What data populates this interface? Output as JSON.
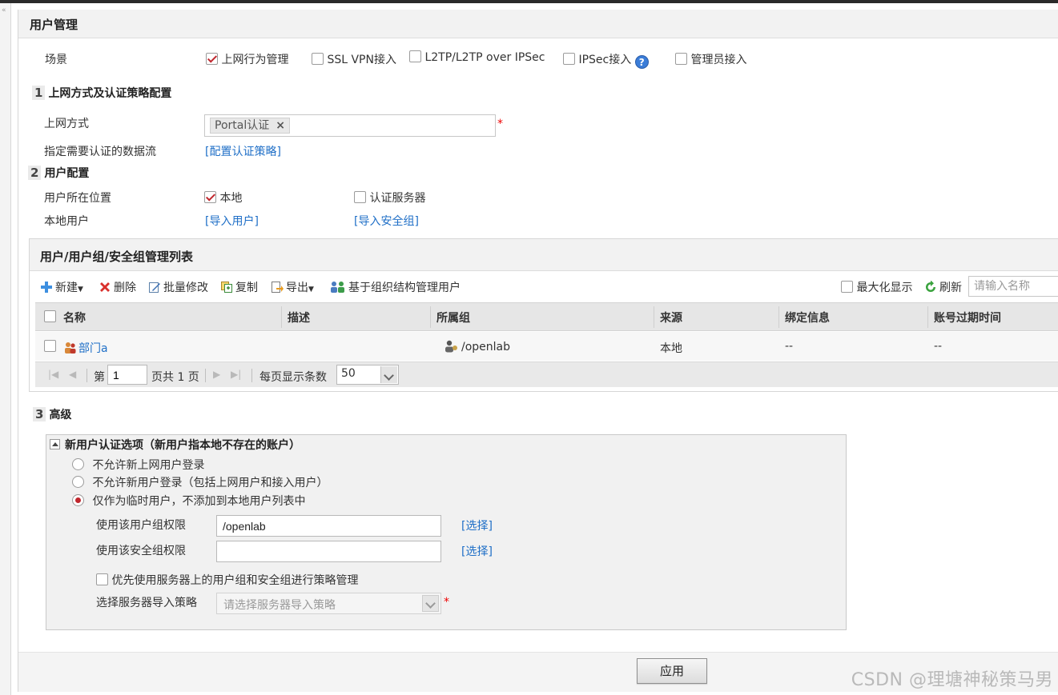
{
  "panel": {
    "title": "用户管理"
  },
  "scene": {
    "label": "场景",
    "options": [
      {
        "label": "上网行为管理",
        "checked": true
      },
      {
        "label": "SSL VPN接入",
        "checked": false
      },
      {
        "label": "L2TP/L2TP over IPSec",
        "checked": false
      },
      {
        "label": "IPSec接入",
        "checked": false,
        "help": "?"
      },
      {
        "label": "管理员接入",
        "checked": false
      }
    ]
  },
  "section1": {
    "num": "1",
    "title": "上网方式及认证策略配置",
    "access_label": "上网方式",
    "access_tag": "Portal认证",
    "tag_remove": "×",
    "required_mark": "*",
    "flow_label": "指定需要认证的数据流",
    "flow_link": "[配置认证策略]"
  },
  "section2": {
    "num": "2",
    "title": "用户配置",
    "location_label": "用户所在位置",
    "location_options": [
      {
        "label": "本地",
        "checked": true
      },
      {
        "label": "认证服务器",
        "checked": false
      }
    ],
    "local_user_label": "本地用户",
    "import_user_link": "[导入用户]",
    "import_group_link": "[导入安全组]"
  },
  "list": {
    "title": "用户/用户组/安全组管理列表",
    "toolbar": {
      "new": "新建",
      "delete": "删除",
      "batch_edit": "批量修改",
      "copy": "复制",
      "export": "导出",
      "org_manage": "基于组织结构管理用户",
      "maximize": "最大化显示",
      "refresh": "刷新",
      "search_placeholder": "请输入名称"
    },
    "columns": [
      "名称",
      "描述",
      "所属组",
      "来源",
      "绑定信息",
      "账号过期时间"
    ],
    "rows": [
      {
        "name": "部门a",
        "desc": "",
        "group": "/openlab",
        "source": "本地",
        "binding": "--",
        "expire": "--"
      }
    ],
    "pager": {
      "page_prefix": "第",
      "page_value": "1",
      "page_suffix": "页共 1 页",
      "per_page_label": "每页显示条数",
      "per_page_value": "50"
    }
  },
  "section3": {
    "num": "3",
    "title": "高级",
    "box_title": "新用户认证选项（新用户指本地不存在的账户）",
    "radios": [
      {
        "label": "不允许新上网用户登录",
        "checked": false
      },
      {
        "label": "不允许新用户登录（包括上网用户和接入用户）",
        "checked": false
      },
      {
        "label": "仅作为临时用户，不添加到本地用户列表中",
        "checked": true
      }
    ],
    "user_group_label": "使用该用户组权限",
    "user_group_value": "/openlab",
    "security_group_label": "使用该安全组权限",
    "security_group_value": "",
    "select_link": "[选择]",
    "prefer_server_label": "优先使用服务器上的用户组和安全组进行策略管理",
    "import_policy_label": "选择服务器导入策略",
    "import_policy_placeholder": "请选择服务器导入策略",
    "required_mark": "*"
  },
  "footer": {
    "apply": "应用"
  },
  "watermark": "CSDN @理塘神秘策马男",
  "colors": {
    "link": "#1f6fc7",
    "check": "#c0262d",
    "required": "#ee0000"
  }
}
